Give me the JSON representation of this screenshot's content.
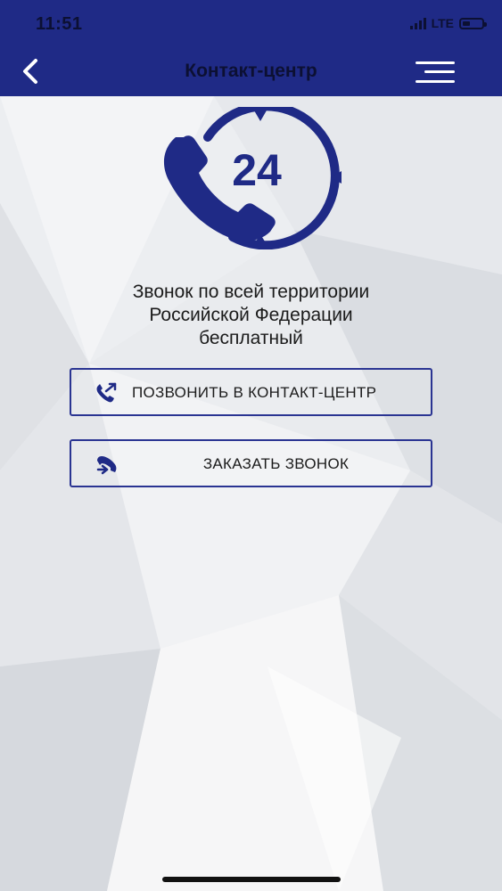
{
  "status_bar": {
    "time": "11:51",
    "network": "LTE",
    "battery_level": 0.4
  },
  "header": {
    "title": "Контакт-центр"
  },
  "logo": {
    "number": "24"
  },
  "description": [
    "Звонок по всей территории",
    "Российской Федерации",
    "бесплатный"
  ],
  "buttons": {
    "call": "ПОЗВОНИТЬ В КОНТАКТ-ЦЕНТР",
    "order": "ЗАКАЗАТЬ ЗВОНОК"
  },
  "colors": {
    "brand": "#1f2a86",
    "accent": "#2a3492",
    "header_text": "#0c1033"
  }
}
